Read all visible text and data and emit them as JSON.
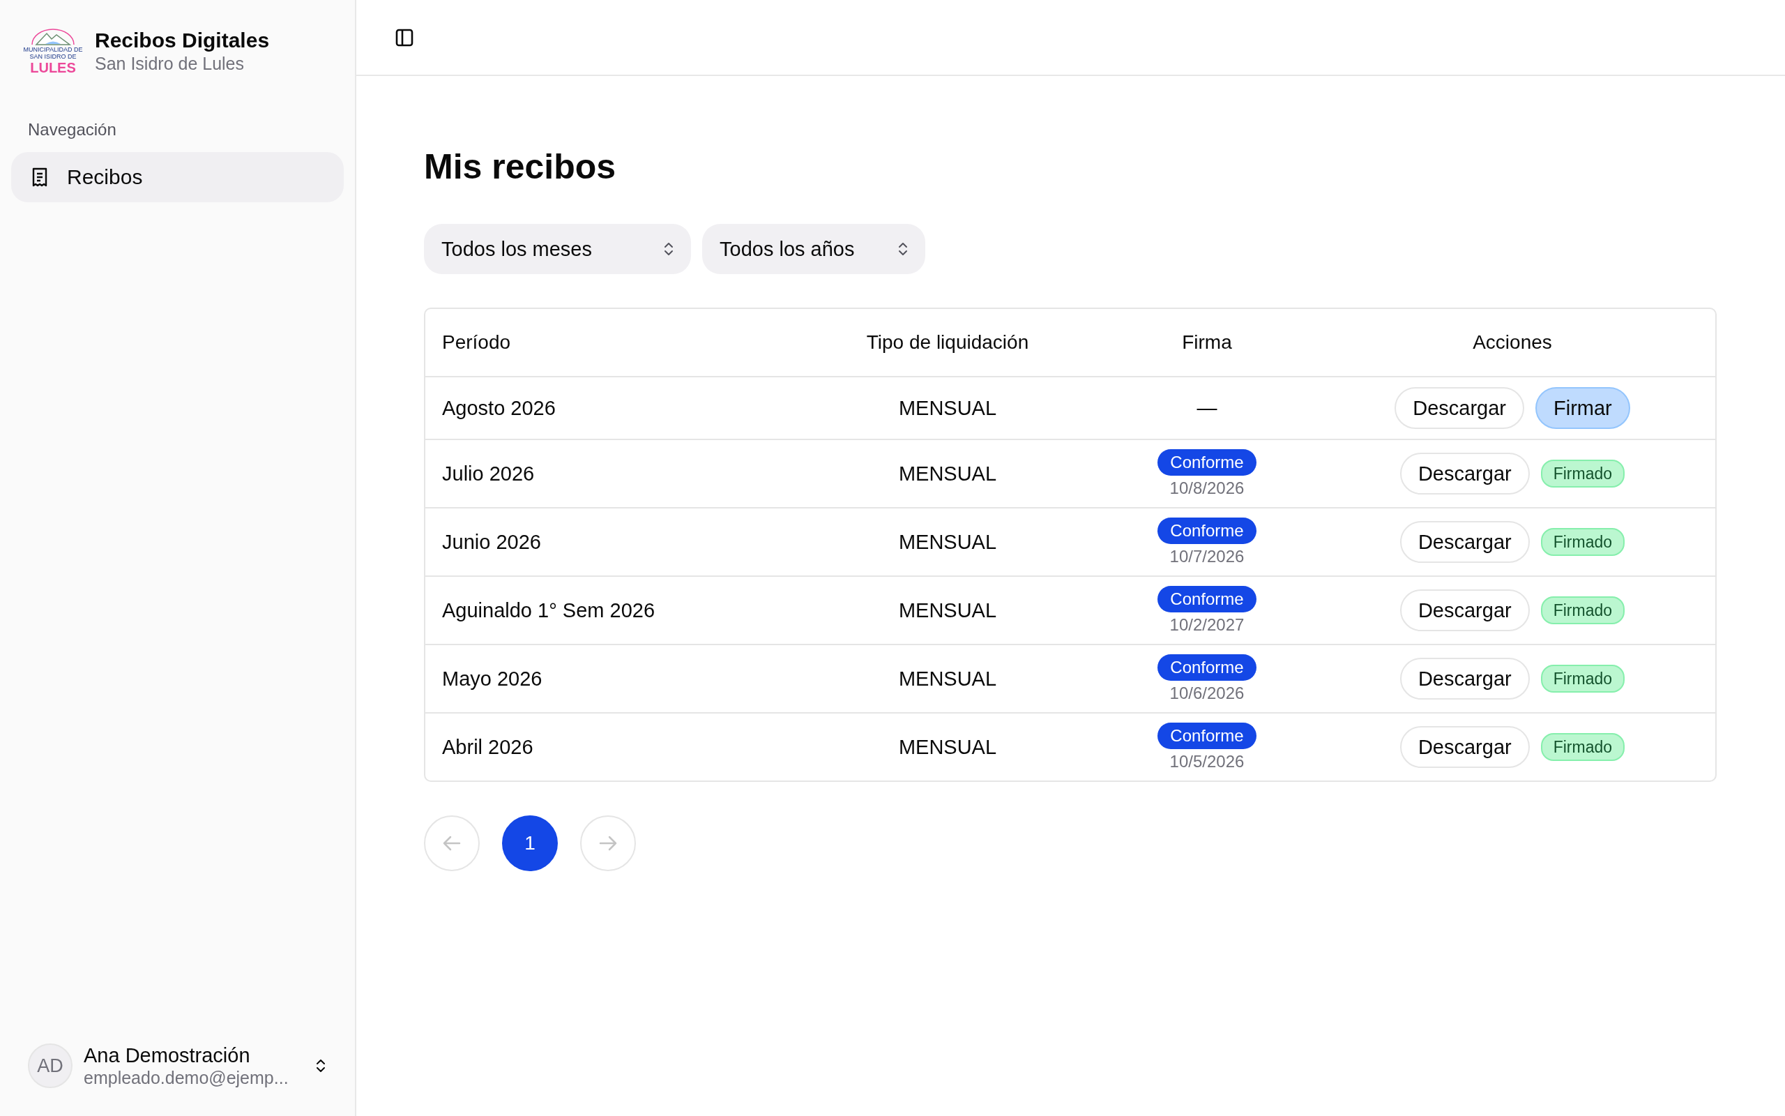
{
  "app": {
    "title": "Recibos Digitales",
    "subtitle": "San Isidro de Lules",
    "logo_lines": [
      "MUNICIPALIDAD DE",
      "SAN ISIDRO DE",
      "LULES"
    ]
  },
  "sidebar": {
    "section_label": "Navegación",
    "items": [
      {
        "label": "Recibos",
        "selected": true
      }
    ]
  },
  "user": {
    "initials": "AD",
    "name": "Ana Demostración",
    "email": "empleado.demo@ejemp..."
  },
  "page": {
    "title": "Mis recibos"
  },
  "filters": [
    {
      "value": "Todos los meses"
    },
    {
      "value": "Todos los años"
    }
  ],
  "table": {
    "columns": [
      "Período",
      "Tipo de liquidación",
      "Firma",
      "Acciones"
    ],
    "rows": [
      {
        "period": "Agosto 2026",
        "type": "MENSUAL",
        "signature": {
          "kind": "none",
          "text": "—"
        },
        "download": "Descargar",
        "sign": {
          "kind": "button",
          "label": "Firmar"
        }
      },
      {
        "period": "Julio 2026",
        "type": "MENSUAL",
        "signature": {
          "kind": "signed",
          "status": "Conforme",
          "date": "10/8/2026"
        },
        "download": "Descargar",
        "sign": {
          "kind": "badge",
          "label": "Firmado"
        }
      },
      {
        "period": "Junio 2026",
        "type": "MENSUAL",
        "signature": {
          "kind": "signed",
          "status": "Conforme",
          "date": "10/7/2026"
        },
        "download": "Descargar",
        "sign": {
          "kind": "badge",
          "label": "Firmado"
        }
      },
      {
        "period": "Aguinaldo 1° Sem 2026",
        "type": "MENSUAL",
        "signature": {
          "kind": "signed",
          "status": "Conforme",
          "date": "10/2/2027"
        },
        "download": "Descargar",
        "sign": {
          "kind": "badge",
          "label": "Firmado"
        }
      },
      {
        "period": "Mayo 2026",
        "type": "MENSUAL",
        "signature": {
          "kind": "signed",
          "status": "Conforme",
          "date": "10/6/2026"
        },
        "download": "Descargar",
        "sign": {
          "kind": "badge",
          "label": "Firmado"
        }
      },
      {
        "period": "Abril 2026",
        "type": "MENSUAL",
        "signature": {
          "kind": "signed",
          "status": "Conforme",
          "date": "10/5/2026"
        },
        "download": "Descargar",
        "sign": {
          "kind": "badge",
          "label": "Firmado"
        }
      }
    ]
  },
  "pagination": {
    "previous": {
      "disabled": true
    },
    "pages": [
      {
        "label": "1",
        "selected": true
      }
    ],
    "next": {
      "disabled": true
    }
  }
}
